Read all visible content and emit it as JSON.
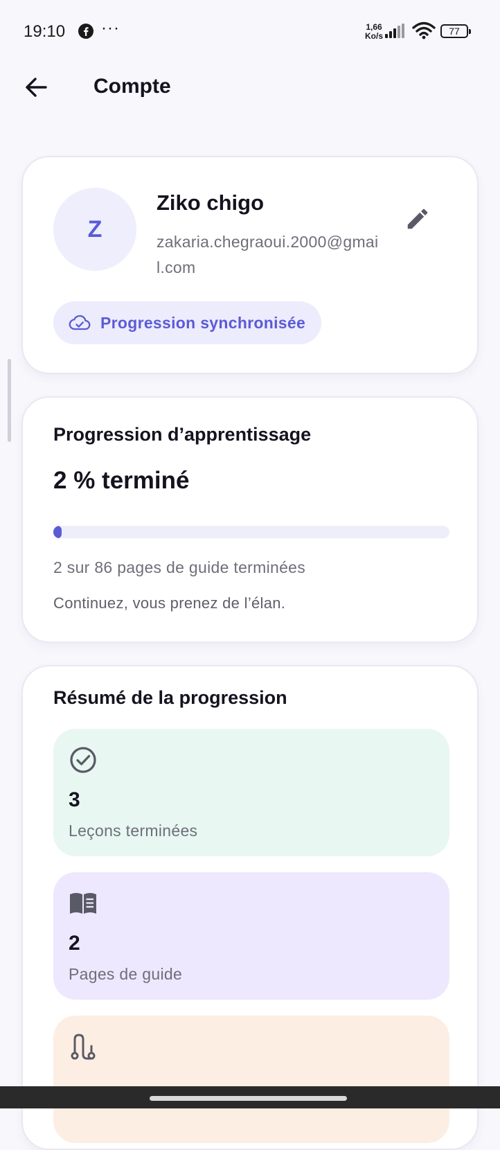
{
  "status_bar": {
    "time": "19:10",
    "notification_icons": [
      "facebook-icon",
      "more-dots-icon"
    ],
    "more_label": "···",
    "net_speed_value": "1,66",
    "net_speed_unit": "Ko/s",
    "battery_level": "77"
  },
  "header": {
    "back_icon": "arrow-left-icon",
    "title": "Compte"
  },
  "profile": {
    "avatar_initial": "Z",
    "name": "Ziko chigo",
    "email": "zakaria.chegraoui.2000@gmail.com",
    "edit_icon": "pencil-icon",
    "sync_icon": "cloud-check-icon",
    "sync_label": "Progression synchronisée"
  },
  "learning_progress": {
    "title": "Progression d’apprentissage",
    "percent_label": "2 % terminé",
    "percent_value": 2,
    "pages_text": "2 sur 86 pages de guide terminées",
    "encouragement": "Continuez, vous prenez de l’élan."
  },
  "summary": {
    "title": "Résumé de la progression",
    "tiles": [
      {
        "icon": "check-circle-icon",
        "value": "3",
        "label": "Leçons terminées",
        "bg": "#e8f7f1"
      },
      {
        "icon": "book-open-icon",
        "value": "2",
        "label": "Pages de guide",
        "bg": "#ede8fd"
      },
      {
        "icon": "route-icon",
        "value": "",
        "label": "",
        "bg": "#fdeee3"
      }
    ]
  },
  "colors": {
    "accent": "#5b5bd6",
    "background": "#f7f7fc",
    "card": "#ffffff",
    "text_primary": "#14131f",
    "text_secondary": "#6e6e7a"
  }
}
